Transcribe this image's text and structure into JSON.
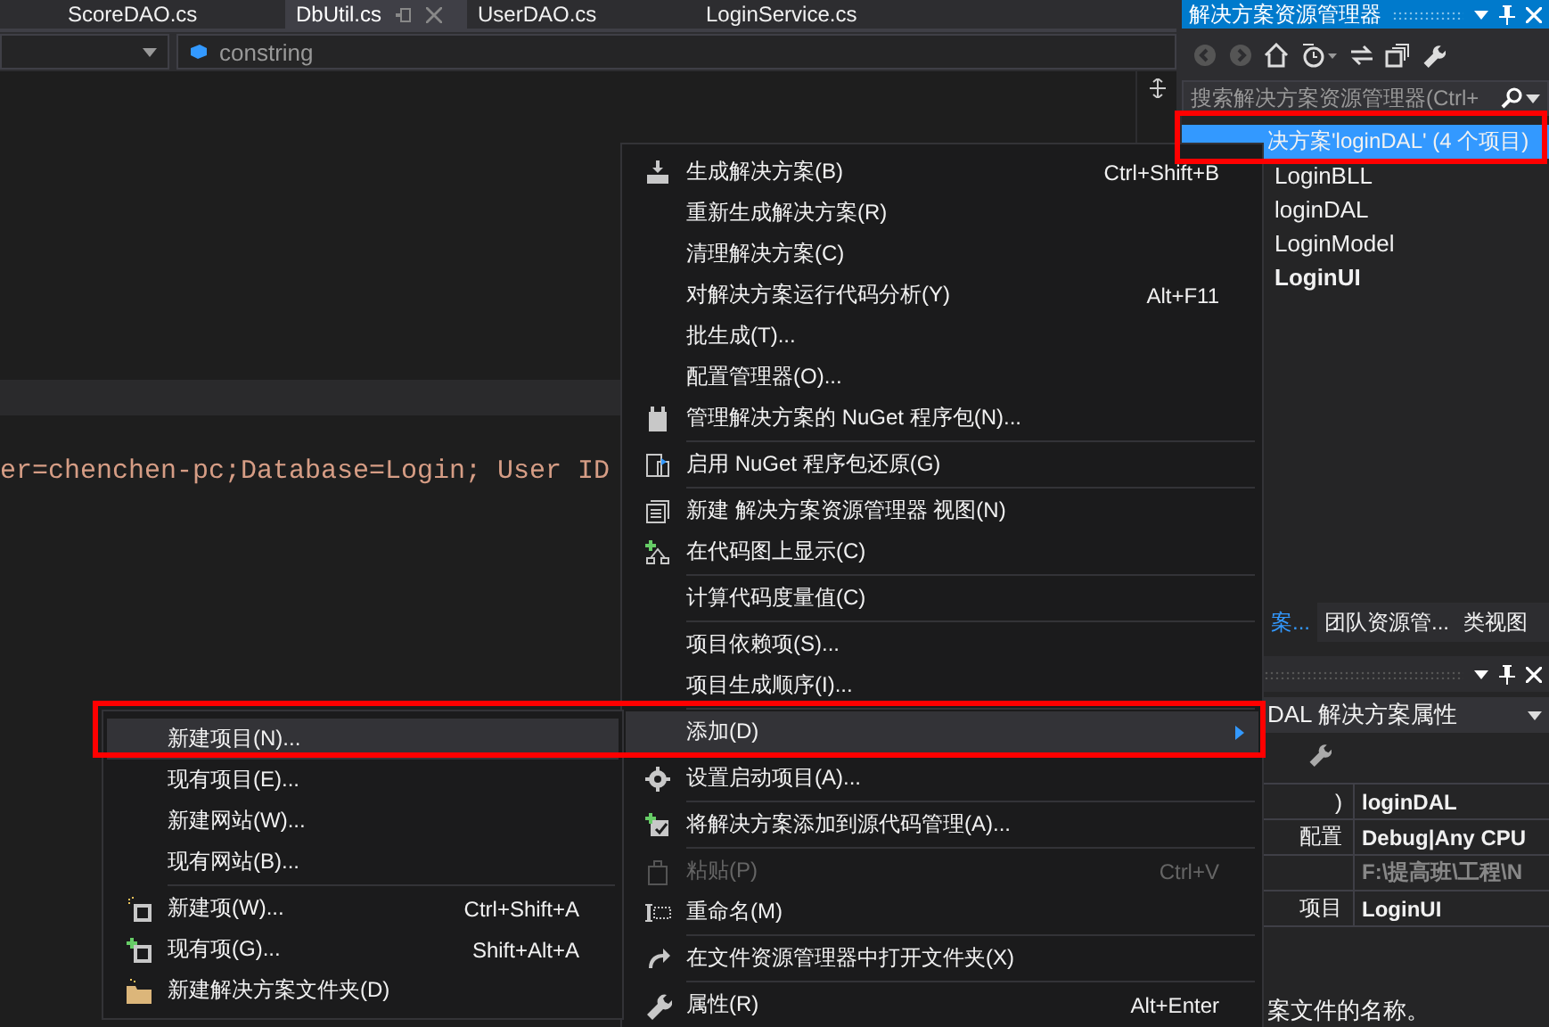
{
  "editor_tabs": [
    {
      "label": "ScoreDAO.cs",
      "selected": false
    },
    {
      "label": "DbUtil.cs",
      "selected": true
    },
    {
      "label": "UserDAO.cs",
      "selected": false
    },
    {
      "label": "LoginService.cs",
      "selected": false
    }
  ],
  "navigation_bar": {
    "member": "constring"
  },
  "code_line": "er=chenchen-pc;Database=Login; User ID",
  "solution_explorer": {
    "title": "解决方案资源管理器",
    "search": {
      "placeholder": "搜索解决方案资源管理器(Ctrl+"
    },
    "tree": [
      {
        "label": "决方案'loginDAL' (4 个项目)",
        "selected": true,
        "bold": false,
        "annotated": true,
        "children": [
          {
            "label": "LoginBLL",
            "selected": false,
            "bold": false
          },
          {
            "label": "loginDAL",
            "selected": false,
            "bold": false
          },
          {
            "label": "LoginModel",
            "selected": false,
            "bold": false
          },
          {
            "label": "LoginUI",
            "selected": false,
            "bold": true
          }
        ]
      }
    ]
  },
  "panel_tabs": [
    {
      "label": "案...",
      "selected": true
    },
    {
      "label": "团队资源管...",
      "selected": false
    },
    {
      "label": "类视图",
      "selected": false
    }
  ],
  "properties": {
    "object": "DAL 解决方案属性",
    "rows": [
      {
        "name": ")",
        "value": "loginDAL",
        "disabled": false
      },
      {
        "name": "配置",
        "value": "Debug|Any CPU",
        "disabled": false
      },
      {
        "value": "F:\\提高班\\工程\\N",
        "disabled": true
      },
      {
        "name": "项目",
        "value": "LoginUI",
        "disabled": false
      }
    ],
    "description": "案文件的名称。"
  },
  "context_menu": {
    "items": [
      {
        "kind": "build",
        "label": "生成解决方案(B)",
        "shortcut": "Ctrl+Shift+B",
        "selected": false,
        "disabled": false
      },
      {
        "kind": "item",
        "label": "重新生成解决方案(R)",
        "selected": false,
        "disabled": false
      },
      {
        "kind": "item",
        "label": "清理解决方案(C)",
        "selected": false,
        "disabled": false
      },
      {
        "kind": "item",
        "label": "对解决方案运行代码分析(Y)",
        "shortcut": "Alt+F11",
        "selected": false,
        "disabled": false
      },
      {
        "kind": "item",
        "label": "批生成(T)...",
        "selected": false,
        "disabled": false
      },
      {
        "kind": "item",
        "label": "配置管理器(O)...",
        "selected": false,
        "disabled": false
      },
      {
        "kind": "package",
        "label": "管理解决方案的 NuGet 程序包(N)...",
        "selected": false,
        "disabled": false
      },
      {
        "kind": "separator"
      },
      {
        "kind": "restore",
        "label": "启用 NuGet 程序包还原(G)",
        "selected": false,
        "disabled": false
      },
      {
        "kind": "separator"
      },
      {
        "kind": "window",
        "label": "新建 解决方案资源管理器 视图(N)",
        "selected": false,
        "disabled": false
      },
      {
        "kind": "diagram",
        "label": "在代码图上显示(C)",
        "selected": false,
        "disabled": false
      },
      {
        "kind": "separator"
      },
      {
        "kind": "item",
        "label": "计算代码度量值(C)",
        "selected": false,
        "disabled": false
      },
      {
        "kind": "separator"
      },
      {
        "kind": "item",
        "label": "项目依赖项(S)...",
        "selected": false,
        "disabled": false
      },
      {
        "kind": "item",
        "label": "项目生成顺序(I)...",
        "selected": false,
        "disabled": false
      },
      {
        "kind": "separator"
      },
      {
        "kind": "item",
        "label": "添加(D)",
        "submenu": true,
        "selected": true,
        "disabled": false,
        "annotated": true
      },
      {
        "kind": "separator"
      },
      {
        "kind": "gear",
        "label": "设置启动项目(A)...",
        "selected": false,
        "disabled": false
      },
      {
        "kind": "separator"
      },
      {
        "kind": "source",
        "label": "将解决方案添加到源代码管理(A)...",
        "selected": false,
        "disabled": false
      },
      {
        "kind": "separator"
      },
      {
        "kind": "paste",
        "label": "粘贴(P)",
        "shortcut": "Ctrl+V",
        "selected": false,
        "disabled": true
      },
      {
        "kind": "rename",
        "label": "重命名(M)",
        "selected": false,
        "disabled": false
      },
      {
        "kind": "separator"
      },
      {
        "kind": "redo",
        "label": "在文件资源管理器中打开文件夹(X)",
        "selected": false,
        "disabled": false
      },
      {
        "kind": "separator"
      },
      {
        "kind": "wrench",
        "label": "属性(R)",
        "shortcut": "Alt+Enter",
        "selected": false,
        "disabled": false
      }
    ]
  },
  "add_submenu": {
    "items": [
      {
        "kind": "item",
        "label": "新建项目(N)...",
        "selected": true,
        "disabled": false
      },
      {
        "kind": "item",
        "label": "现有项目(E)...",
        "selected": false,
        "disabled": false
      },
      {
        "kind": "item",
        "label": "新建网站(W)...",
        "selected": false,
        "disabled": false
      },
      {
        "kind": "item",
        "label": "现有网站(B)...",
        "selected": false,
        "disabled": false
      },
      {
        "kind": "separator"
      },
      {
        "kind": "newitem",
        "label": "新建项(W)...",
        "shortcut": "Ctrl+Shift+A",
        "selected": false,
        "disabled": false
      },
      {
        "kind": "existingitem",
        "label": "现有项(G)...",
        "shortcut": "Shift+Alt+A",
        "selected": false,
        "disabled": false
      },
      {
        "kind": "folder",
        "label": "新建解决方案文件夹(D)",
        "selected": false,
        "disabled": false
      }
    ]
  }
}
